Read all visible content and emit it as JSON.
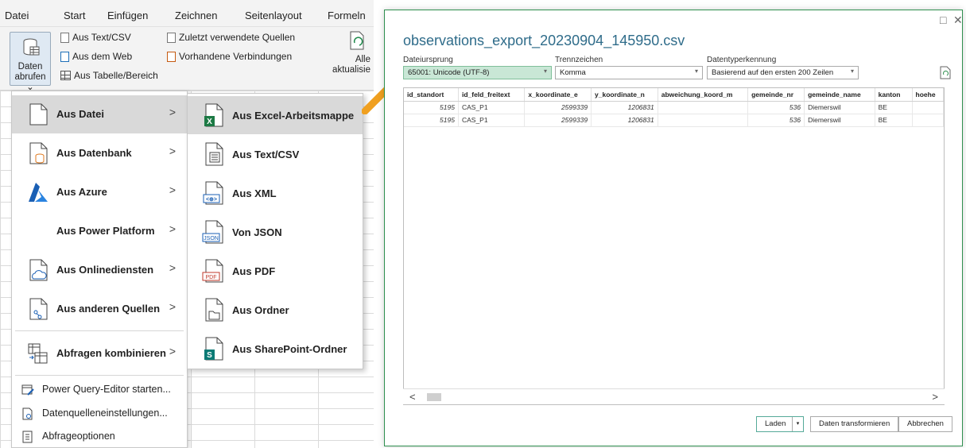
{
  "excel": {
    "menu_tabs": [
      "Datei",
      "Start",
      "Einfügen",
      "Zeichnen",
      "Seitenlayout",
      "Formeln"
    ],
    "ribbon": {
      "get_data_line1": "Daten",
      "get_data_line2": "abrufen ⌄",
      "from_text_csv": "Aus Text/CSV",
      "from_web": "Aus dem Web",
      "from_table": "Aus Tabelle/Bereich",
      "recent_sources": "Zuletzt verwendete Quellen",
      "existing_connections": "Vorhandene Verbindungen",
      "refresh_all_line1": "Alle",
      "refresh_all_line2": "aktualisie"
    }
  },
  "menu": {
    "items": [
      {
        "label": "Aus Datei",
        "icon": "file-icon"
      },
      {
        "label": "Aus Datenbank",
        "icon": "database-icon"
      },
      {
        "label": "Aus Azure",
        "icon": "azure-icon"
      },
      {
        "label": "Aus Power Platform",
        "icon": ""
      },
      {
        "label": "Aus Onlinediensten",
        "icon": "cloud-icon"
      },
      {
        "label": "Aus anderen Quellen",
        "icon": "other-sources-icon"
      },
      {
        "label": "Abfragen kombinieren",
        "icon": "combine-icon"
      }
    ],
    "small_items": [
      {
        "label": "Power Query-Editor starten..."
      },
      {
        "label": "Datenquelleneinstellungen..."
      },
      {
        "label": "Abfrageoptionen"
      }
    ]
  },
  "submenu": {
    "items": [
      {
        "label": "Aus Excel-Arbeitsmappe"
      },
      {
        "label": "Aus Text/CSV"
      },
      {
        "label": "Aus XML"
      },
      {
        "label": "Von JSON"
      },
      {
        "label": "Aus PDF"
      },
      {
        "label": "Aus Ordner"
      },
      {
        "label": "Aus SharePoint-Ordner"
      }
    ],
    "badges": {
      "xml": "<⊕>",
      "json": "JSON",
      "pdf": "PDF",
      "excel": "X",
      "sharepoint": "S"
    }
  },
  "dialog": {
    "title": "observations_export_20230904_145950.csv",
    "file_origin_label": "Dateiursprung",
    "file_origin_value": "65001: Unicode (UTF-8)",
    "delimiter_label": "Trennzeichen",
    "delimiter_value": "Komma",
    "type_detection_label": "Datentyperkennung",
    "type_detection_value": "Basierend auf den ersten 200 Zeilen",
    "columns": [
      "id_standort",
      "id_feld_freitext",
      "x_koordinate_e",
      "y_koordinate_n",
      "abweichung_koord_m",
      "gemeinde_nr",
      "gemeinde_name",
      "kanton",
      "hoehe"
    ],
    "rows": [
      [
        "5195",
        "CAS_P1",
        "2599339",
        "1206831",
        "",
        "536",
        "Diemerswil",
        "BE",
        ""
      ],
      [
        "5195",
        "CAS_P1",
        "2599339",
        "1206831",
        "",
        "536",
        "Diemerswil",
        "BE",
        ""
      ]
    ],
    "buttons": {
      "load": "Laden",
      "transform": "Daten transformieren",
      "cancel": "Abbrechen"
    },
    "window_controls": {
      "maximize": "□",
      "close": "✕"
    }
  },
  "colors": {
    "accent_green": "#2f8f4f",
    "title_blue": "#2f6c8a",
    "arrow_orange": "#f0a020"
  }
}
